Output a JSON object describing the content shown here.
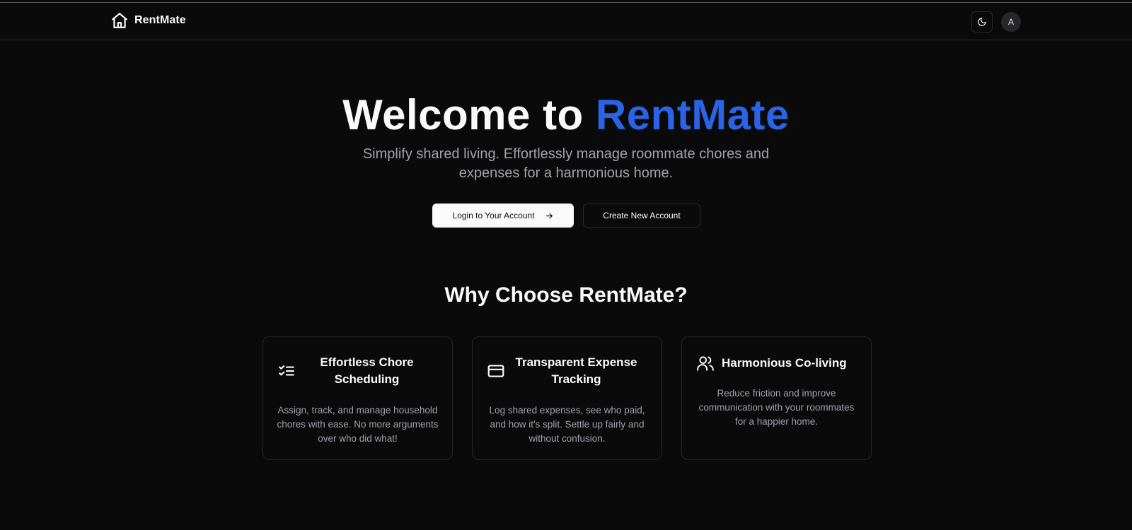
{
  "header": {
    "brand_name": "RentMate",
    "brand_icon": "home-icon",
    "theme_toggle_icon": "moon-icon",
    "avatar_initial": "A"
  },
  "hero": {
    "title_prefix": "Welcome to ",
    "title_accent": "RentMate",
    "subtitle": "Simplify shared living. Effortlessly manage roommate chores and expenses for a harmonious home.",
    "login_label": "Login to Your Account",
    "login_icon": "arrow-right-icon",
    "create_label": "Create New Account"
  },
  "features": {
    "title": "Why Choose RentMate?",
    "cards": [
      {
        "icon": "checklist-icon",
        "title": "Effortless Chore Scheduling",
        "description": "Assign, track, and manage household chores with ease. No more arguments over who did what!"
      },
      {
        "icon": "credit-card-icon",
        "title": "Transparent Expense Tracking",
        "description": "Log shared expenses, see who paid, and how it's split. Settle up fairly and without confusion."
      },
      {
        "icon": "users-icon",
        "title": "Harmonious Co-living",
        "description": "Reduce friction and improve communication with your roommates for a happier home."
      }
    ]
  },
  "colors": {
    "background": "#0a0a0b",
    "accent": "#2b63e6",
    "muted_text": "#a1a1aa",
    "border": "#26262a"
  }
}
